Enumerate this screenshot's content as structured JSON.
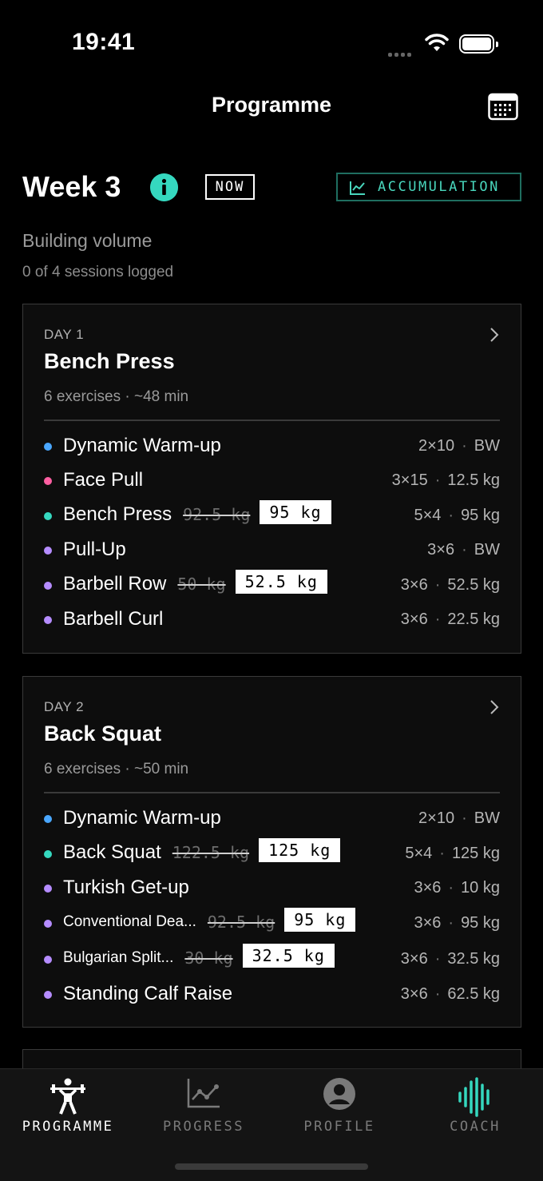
{
  "status": {
    "time": "19:41"
  },
  "nav": {
    "title": "Programme"
  },
  "week": {
    "title": "Week 3",
    "now_badge": "NOW",
    "phase_badge": "ACCUMULATION",
    "subtitle": "Building volume",
    "sessions": "0 of 4 sessions logged"
  },
  "colors": {
    "accent": "#35d8bf",
    "blue": "#4aa7ff",
    "pink": "#ff5fa2",
    "teal": "#35d8bf",
    "purple": "#b58cff"
  },
  "days": [
    {
      "label": "DAY 1",
      "title": "Bench Press",
      "meta": "6 exercises · ~48 min",
      "exercises": [
        {
          "name": "Dynamic Warm-up",
          "sets": "2×10",
          "load": "BW",
          "color": "#4aa7ff"
        },
        {
          "name": "Face Pull",
          "sets": "3×15",
          "load": "12.5 kg",
          "color": "#ff5fa2"
        },
        {
          "name": "Bench Press",
          "old": "92.5 kg",
          "new": "95 kg",
          "sets": "5×4",
          "load": "95 kg",
          "color": "#35d8bf"
        },
        {
          "name": "Pull-Up",
          "sets": "3×6",
          "load": "BW",
          "color": "#b58cff"
        },
        {
          "name": "Barbell Row",
          "old": "50 kg",
          "new": "52.5 kg",
          "sets": "3×6",
          "load": "52.5 kg",
          "color": "#b58cff"
        },
        {
          "name": "Barbell Curl",
          "sets": "3×6",
          "load": "22.5 kg",
          "color": "#b58cff"
        }
      ]
    },
    {
      "label": "DAY 2",
      "title": "Back Squat",
      "meta": "6 exercises · ~50 min",
      "exercises": [
        {
          "name": "Dynamic Warm-up",
          "sets": "2×10",
          "load": "BW",
          "color": "#4aa7ff"
        },
        {
          "name": "Back Squat",
          "old": "122.5 kg",
          "new": "125 kg",
          "sets": "5×4",
          "load": "125 kg",
          "color": "#35d8bf"
        },
        {
          "name": "Turkish Get-up",
          "sets": "3×6",
          "load": "10 kg",
          "color": "#b58cff"
        },
        {
          "name": "Conventional Dea...",
          "old": "92.5 kg",
          "new": "95 kg",
          "sets": "3×6",
          "load": "95 kg",
          "color": "#b58cff"
        },
        {
          "name": "Bulgarian Split...",
          "old": "30 kg",
          "new": "32.5 kg",
          "sets": "3×6",
          "load": "32.5 kg",
          "color": "#b58cff"
        },
        {
          "name": "Standing Calf Raise",
          "sets": "3×6",
          "load": "62.5 kg",
          "color": "#b58cff"
        }
      ]
    }
  ],
  "tabs": [
    {
      "label": "PROGRAMME",
      "icon": "weightlifter-icon"
    },
    {
      "label": "PROGRESS",
      "icon": "chart-icon"
    },
    {
      "label": "PROFILE",
      "icon": "person-icon"
    },
    {
      "label": "COACH",
      "icon": "waveform-icon"
    }
  ],
  "sep": "·"
}
